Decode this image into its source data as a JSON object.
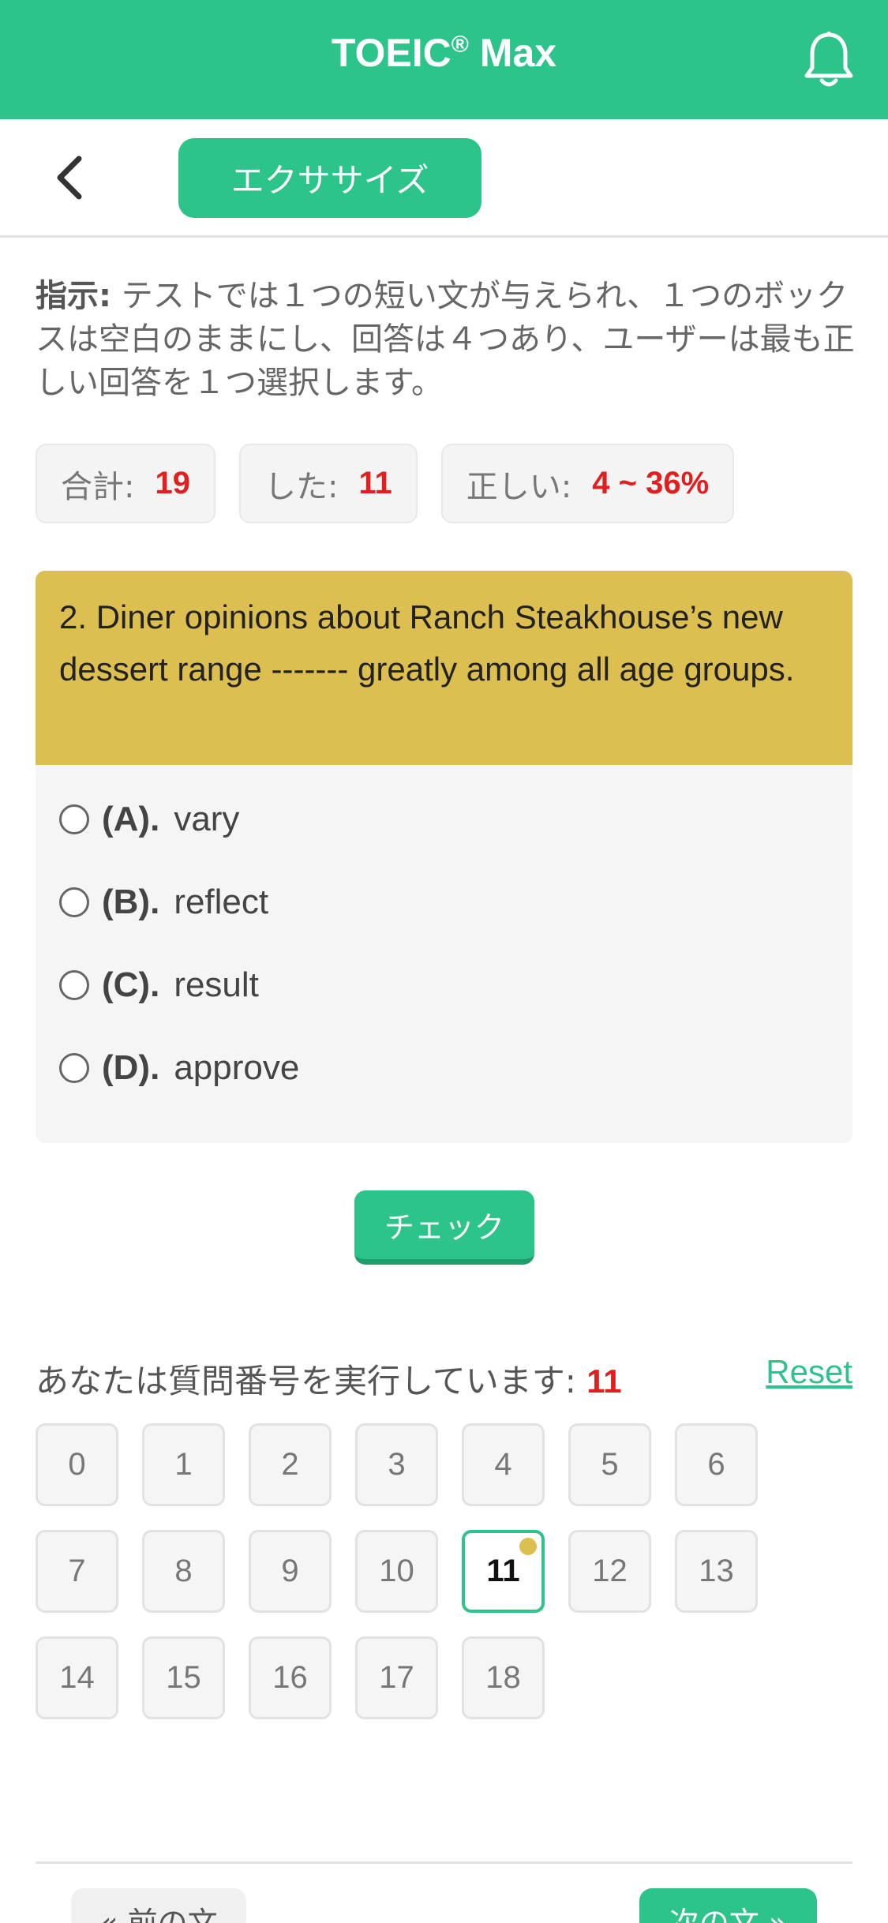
{
  "appbar": {
    "title_main": "TOEIC",
    "title_sup": "®",
    "title_tail": " Max"
  },
  "toolbar": {
    "tab_label": "エクササイズ"
  },
  "instructions": {
    "label": "指示:",
    "text": " テストでは１つの短い文が与えられ、１つのボックスは空白のままにし、回答は４つあり、ユーザーは最も正しい回答を１つ選択します。"
  },
  "stats": [
    {
      "label": "合計:",
      "value": "19"
    },
    {
      "label": "した:",
      "value": "11"
    },
    {
      "label": "正しい:",
      "value": "4 ~ 36%"
    }
  ],
  "question": {
    "text": "2. Diner opinions about Ranch Steakhouse’s new dessert range ------- greatly among all age groups.",
    "options": [
      {
        "label": "(A).",
        "text": "vary"
      },
      {
        "label": "(B).",
        "text": "reflect"
      },
      {
        "label": "(C).",
        "text": "result"
      },
      {
        "label": "(D).",
        "text": "approve"
      }
    ]
  },
  "check_label": "チェック",
  "progress": {
    "text": "あなたは質問番号を実行しています: ",
    "current": "11",
    "reset_label": "Reset"
  },
  "numbers": [
    "0",
    "1",
    "2",
    "3",
    "4",
    "5",
    "6",
    "7",
    "8",
    "9",
    "10",
    "11",
    "12",
    "13",
    "14",
    "15",
    "16",
    "17",
    "18"
  ],
  "active_number": "11",
  "nav": {
    "prev_label": "« 前の文",
    "next_label": "次の文 »"
  },
  "colors": {
    "primary": "#2dc48b",
    "question_bg": "#dcbf50",
    "accent_red": "#e02020"
  }
}
